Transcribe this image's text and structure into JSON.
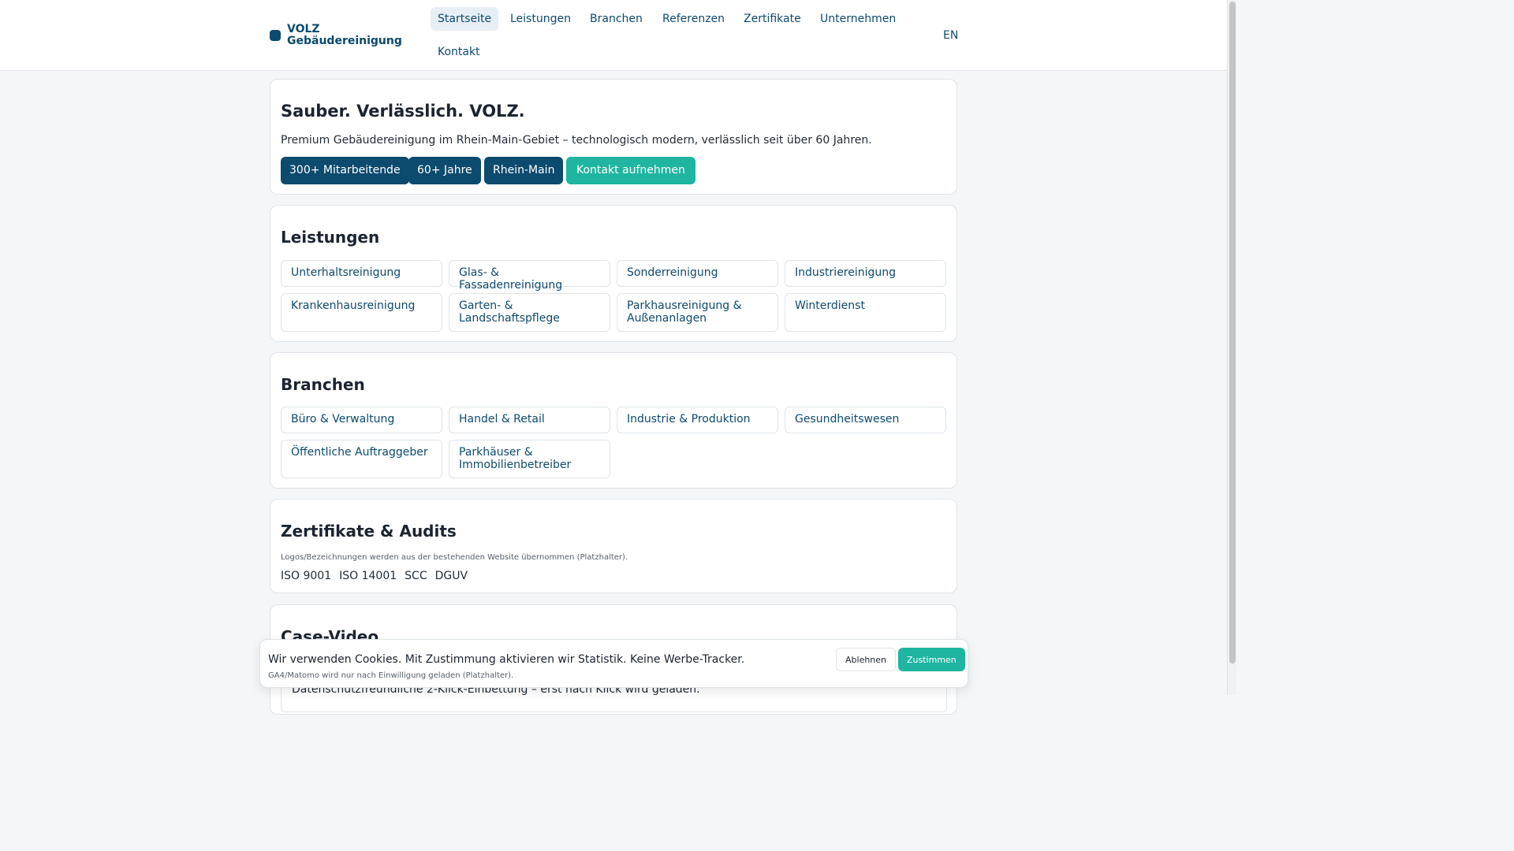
{
  "header": {
    "brand": "VOLZ Gebäudereinigung",
    "nav": [
      "Startseite",
      "Leistungen",
      "Branchen",
      "Referenzen",
      "Zertifikate",
      "Unternehmen",
      "Kontakt"
    ],
    "lang": "EN"
  },
  "hero": {
    "title": "Sauber. Verlässlich. VOLZ.",
    "subtitle": "Premium Gebäudereinigung im Rhein-Main-Gebiet – technologisch modern, verlässlich seit über 60 Jahren.",
    "badges": [
      "300+ Mitarbeitende",
      "60+ Jahre",
      "Rhein-Main"
    ],
    "cta": "Kontakt aufnehmen"
  },
  "leistungen": {
    "title": "Leistungen",
    "items": [
      "Unterhaltsreinigung",
      "Glas- & Fassadenreinigung",
      "Sonderreinigung",
      "Industriereinigung",
      "Krankenhausreinigung",
      "Garten- & Landschaftspflege",
      "Parkhausreinigung & Außenanlagen",
      "Winterdienst"
    ]
  },
  "branchen": {
    "title": "Branchen",
    "items": [
      "Büro & Verwaltung",
      "Handel & Retail",
      "Industrie & Produktion",
      "Gesundheitswesen",
      "Öffentliche Auftraggeber",
      "Parkhäuser & Immobilienbetreiber"
    ]
  },
  "zertifikate": {
    "title": "Zertifikate & Audits",
    "note": "Logos/Bezeichnungen werden aus der bestehenden Website übernommen (Platzhalter).",
    "items": [
      "ISO 9001",
      "ISO 14001",
      "SCC",
      "DGUV"
    ]
  },
  "video": {
    "title": "Case-Video",
    "text": "Datenschutzfreundliche 2-Klick-Einbettung – erst nach Klick wird geladen."
  },
  "cookie": {
    "text": "Wir verwenden Cookies. Mit Zustimmung aktivieren wir Statistik. Keine Werbe-Tracker.",
    "note": "GA4/Matomo wird nur nach Einwilligung geladen (Platzhalter).",
    "decline": "Ablehnen",
    "accept": "Zustimmen"
  }
}
